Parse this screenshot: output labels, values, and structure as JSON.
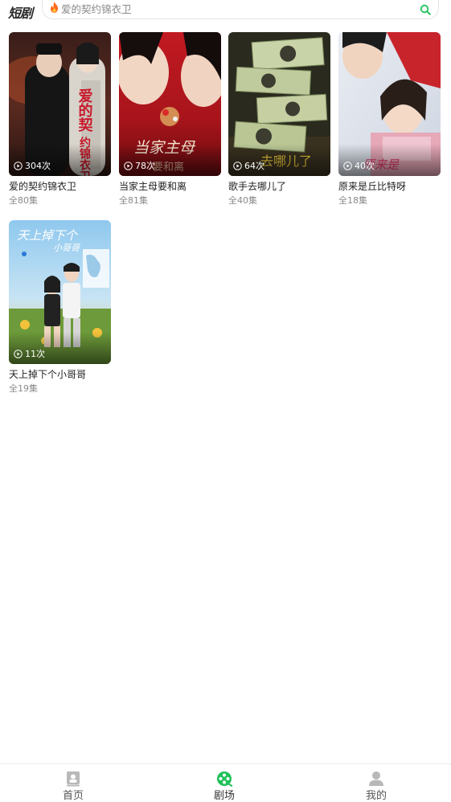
{
  "header": {
    "logo": "短剧",
    "search_placeholder": "爱的契约锦衣卫"
  },
  "colors": {
    "accent": "#20c15a",
    "fire": "#ff6a1a",
    "muted": "#8a8a8a"
  },
  "dramas": [
    {
      "title": "爱的契约锦衣卫",
      "episodes": "全80集",
      "plays": "304次"
    },
    {
      "title": "当家主母要和离",
      "episodes": "全81集",
      "plays": "78次"
    },
    {
      "title": "歌手去哪儿了",
      "episodes": "全40集",
      "plays": "64次"
    },
    {
      "title": "原来是丘比特呀",
      "episodes": "全18集",
      "plays": "40次"
    },
    {
      "title": "天上掉下个小哥哥",
      "episodes": "全19集",
      "plays": "11次"
    }
  ],
  "tabbar": [
    {
      "label": "首页",
      "icon": "home-icon"
    },
    {
      "label": "剧场",
      "icon": "theater-icon",
      "active": true
    },
    {
      "label": "我的",
      "icon": "profile-icon"
    }
  ]
}
